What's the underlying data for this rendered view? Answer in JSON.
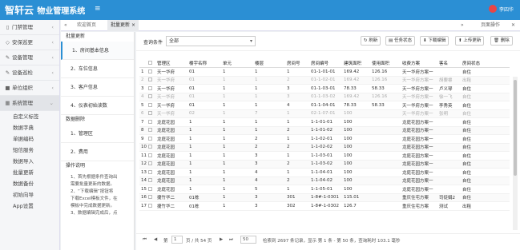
{
  "header": {
    "app_name": "智轩云",
    "app_sub": "物业管理系统",
    "username": "李四华",
    "menu_icon": "≡"
  },
  "sidebar": {
    "items": [
      {
        "label": "门禁管理",
        "icon": "▯"
      },
      {
        "label": "安保巡更",
        "icon": "◇"
      },
      {
        "label": "设备管理",
        "icon": "✎"
      },
      {
        "label": "设备巡检",
        "icon": "✎"
      },
      {
        "label": "单位组织",
        "icon": "■"
      },
      {
        "label": "系统管理",
        "icon": "▦"
      }
    ],
    "sub_items": [
      "自定义标签",
      "数据字典",
      "单据编码",
      "短信服务",
      "数据导入",
      "批量更新",
      "数据备份",
      "初始向导",
      "App设置"
    ]
  },
  "tabs": {
    "home_icon": "«",
    "items": [
      "欢迎首页",
      "批量更新"
    ],
    "close": "×",
    "next": "»",
    "ops": "页面操作",
    "close_all": "✕"
  },
  "left_panel": {
    "section1": "批量更新",
    "items1": [
      "1、房间基本信息",
      "2、车位信息",
      "3、客户信息",
      "4、仪表初始读数"
    ],
    "section2": "数据删除",
    "items2": [
      "1、管理区",
      "2、费用"
    ],
    "section3": "操作说明",
    "help": [
      "1、首先根据条件查询出",
      "需要批量更新的数据。",
      "2、“下载编辑”按钮将",
      "下载Excel模板文件，在",
      "模板中完成数据更新。",
      "3、数据编辑完成后，点"
    ]
  },
  "query": {
    "label": "查询条件",
    "value": "全部"
  },
  "buttons": {
    "refresh": "↻ 刷新",
    "status": "▤ 任务状态",
    "download": "⬇ 下载编辑",
    "upload": "⬆ 上传更新",
    "delete": "🗑 删除"
  },
  "table": {
    "headers": [
      "",
      "",
      "管理区",
      "楼宇名称",
      "单元",
      "楼层",
      "房间号",
      "房间编号",
      "建筑面积",
      "使用面积",
      "收费方案",
      "客名",
      "房间状态"
    ],
    "rows": [
      [
        "1",
        "",
        "天一华府",
        "01",
        "1",
        "1",
        "1",
        "01-1-01-01",
        "169.42",
        "126.16",
        "天一华府方案一",
        "",
        "自住"
      ],
      [
        "2",
        "",
        "天一华府",
        "01",
        "1",
        "1",
        "2",
        "01-1-02-01",
        "169.42",
        "126.16",
        "天一华府方案一",
        "胡要睿",
        "出租"
      ],
      [
        "3",
        "",
        "天一华府",
        "01",
        "1",
        "1",
        "3",
        "01-1-03-01",
        "78.33",
        "58.33",
        "天一华府方案一",
        "卢义琴",
        "自住"
      ],
      [
        "4",
        "",
        "天一华府",
        "01",
        "1",
        "1",
        "3",
        "01-1-03-02",
        "169.42",
        "126.16",
        "天一华府方案一",
        "徐一飞",
        "自住"
      ],
      [
        "5",
        "",
        "天一华府",
        "01",
        "1",
        "1",
        "4",
        "01-1-04-01",
        "78.33",
        "58.33",
        "天一华府方案一",
        "李秀英",
        "自住"
      ],
      [
        "6",
        "",
        "天一华府",
        "02",
        "1",
        "7",
        "1",
        "02-1-07-01",
        "100",
        "",
        "天一华府方案一",
        "张明",
        "自住"
      ],
      [
        "7",
        "",
        "龙庭花园",
        "1",
        "1",
        "1",
        "1",
        "1-1-01-01",
        "100",
        "",
        "龙庭花园方案一",
        "",
        "自住"
      ],
      [
        "8",
        "",
        "龙庭花园",
        "1",
        "1",
        "1",
        "2",
        "1-1-01-02",
        "100",
        "",
        "龙庭花园方案一",
        "",
        "自住"
      ],
      [
        "9",
        "",
        "龙庭花园",
        "1",
        "1",
        "2",
        "1",
        "1-1-02-01",
        "100",
        "",
        "龙庭花园方案一",
        "",
        "自住"
      ],
      [
        "10",
        "",
        "龙庭花园",
        "1",
        "1",
        "2",
        "2",
        "1-1-02-02",
        "100",
        "",
        "龙庭花园方案一",
        "",
        "自住"
      ],
      [
        "11",
        "",
        "龙庭花园",
        "1",
        "1",
        "3",
        "1",
        "1-1-03-01",
        "100",
        "",
        "龙庭花园方案一",
        "",
        "自住"
      ],
      [
        "12",
        "",
        "龙庭花园",
        "1",
        "1",
        "3",
        "2",
        "1-1-03-02",
        "100",
        "",
        "龙庭花园方案一",
        "",
        "自住"
      ],
      [
        "13",
        "",
        "龙庭花园",
        "1",
        "1",
        "4",
        "1",
        "1-1-04-01",
        "100",
        "",
        "龙庭花园方案一",
        "",
        "自住"
      ],
      [
        "14",
        "",
        "龙庭花园",
        "1",
        "1",
        "4",
        "2",
        "1-1-04-02",
        "100",
        "",
        "龙庭花园方案一",
        "",
        "自住"
      ],
      [
        "15",
        "",
        "龙庭花园",
        "1",
        "1",
        "5",
        "1",
        "1-1-05-01",
        "100",
        "",
        "龙庭花园方案一",
        "",
        "自住"
      ],
      [
        "16",
        "",
        "捷竹华二",
        "01栋",
        "1",
        "3",
        "301",
        "1-8#-1-0301",
        "115.01",
        "",
        "重庆住宅方案",
        "司徒娟2",
        "自住"
      ],
      [
        "17",
        "",
        "捷竹华二",
        "01栋",
        "1",
        "3",
        "302",
        "1-8#-1-0302",
        "126.7",
        "",
        "重庆住宅方案",
        "测试",
        "出租"
      ]
    ]
  },
  "pager": {
    "first": "⏮",
    "prev": "◀",
    "page_label": "第",
    "page": "1",
    "of": "页 / 共 54 页",
    "next": "▶",
    "last": "⏭",
    "size": "50",
    "summary": "检索到 2697 条记录，显示 第 1 条 - 第 50 条，查询耗时 103.1 毫秒"
  }
}
